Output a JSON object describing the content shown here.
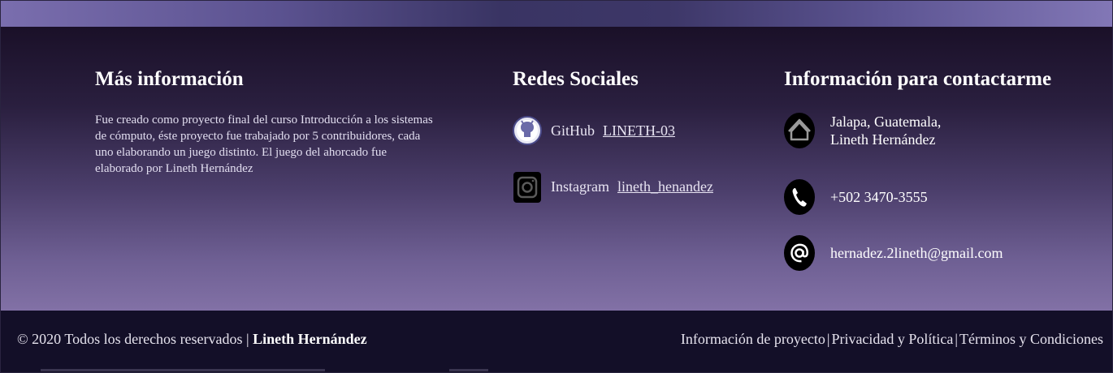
{
  "about": {
    "title": "Más información",
    "text": "Fue creado como proyecto final del curso Introducción a los sistemas de cómputo, éste proyecto fue trabajado por 5 contribuidores, cada uno elaborando un juego distinto. El juego del ahorcado fue elaborado por Lineth Hernández"
  },
  "social": {
    "title": "Redes Sociales",
    "items": [
      {
        "name": "GitHub",
        "handle": "LINETH-03",
        "icon": "github-icon"
      },
      {
        "name": "Instagram",
        "handle": "lineth_henandez",
        "icon": "instagram-icon"
      }
    ]
  },
  "contact": {
    "title": "Información para contactarme",
    "address_line1": "Jalapa, Guatemala,",
    "address_line2": "Lineth Hernández",
    "phone": "+502 3470-3555",
    "email": "hernadez.2lineth@gmail.com",
    "icons": [
      "home-icon",
      "phone-icon",
      "at-icon"
    ]
  },
  "footer": {
    "copyright": "© 2020 Todos los derechos reservados |",
    "author": "Lineth Hernández",
    "links": [
      "Información de proyecto",
      "Privacidad y Política",
      "Términos y Condiciones"
    ]
  },
  "colors": {
    "footer_bg": "#130f28",
    "accent_purple": "#7a6eae"
  }
}
